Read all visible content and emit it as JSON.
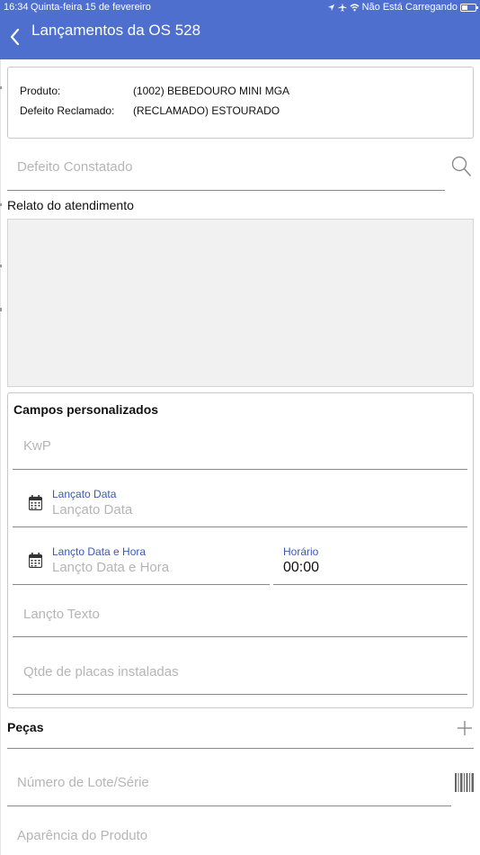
{
  "status_bar": {
    "time": "16:34",
    "date": "Quinta-feira 15 de fevereiro",
    "charging": "Não Está Carregando"
  },
  "nav": {
    "title": "Lançamentos da OS 528",
    "back_icon": "chevron-left-icon"
  },
  "product": {
    "product_label": "Produto:",
    "product_value": "(1002) BEBEDOURO MINI MGA",
    "defect_label": "Defeito Reclamado:",
    "defect_value": "(RECLAMADO) ESTOURADO"
  },
  "defeito_constatado": {
    "placeholder": "Defeito Constatado",
    "icon": "search-icon"
  },
  "relato": {
    "label": "Relato do atendimento",
    "value": ""
  },
  "custom_fields": {
    "title": "Campos personalizados",
    "kwp_placeholder": "KwP",
    "data_label": "Lançato Data",
    "data_placeholder": "Lançato Data",
    "data_hora_label": "Lançto Data e Hora",
    "data_hora_placeholder": "Lançto Data e Hora",
    "horario_label": "Horário",
    "horario_value": "00:00",
    "texto_placeholder": "Lançto Texto",
    "placas_placeholder": "Qtde de placas instaladas"
  },
  "pecas": {
    "title": "Peças",
    "add_icon": "plus-icon"
  },
  "lote": {
    "placeholder": "Número de Lote/Série",
    "icon": "barcode-icon"
  },
  "aparencia": {
    "placeholder": "Aparência do Produto"
  },
  "colors": {
    "header": "#4e6fce",
    "accent_label": "#3c57b8",
    "placeholder": "#b5b5b5"
  }
}
